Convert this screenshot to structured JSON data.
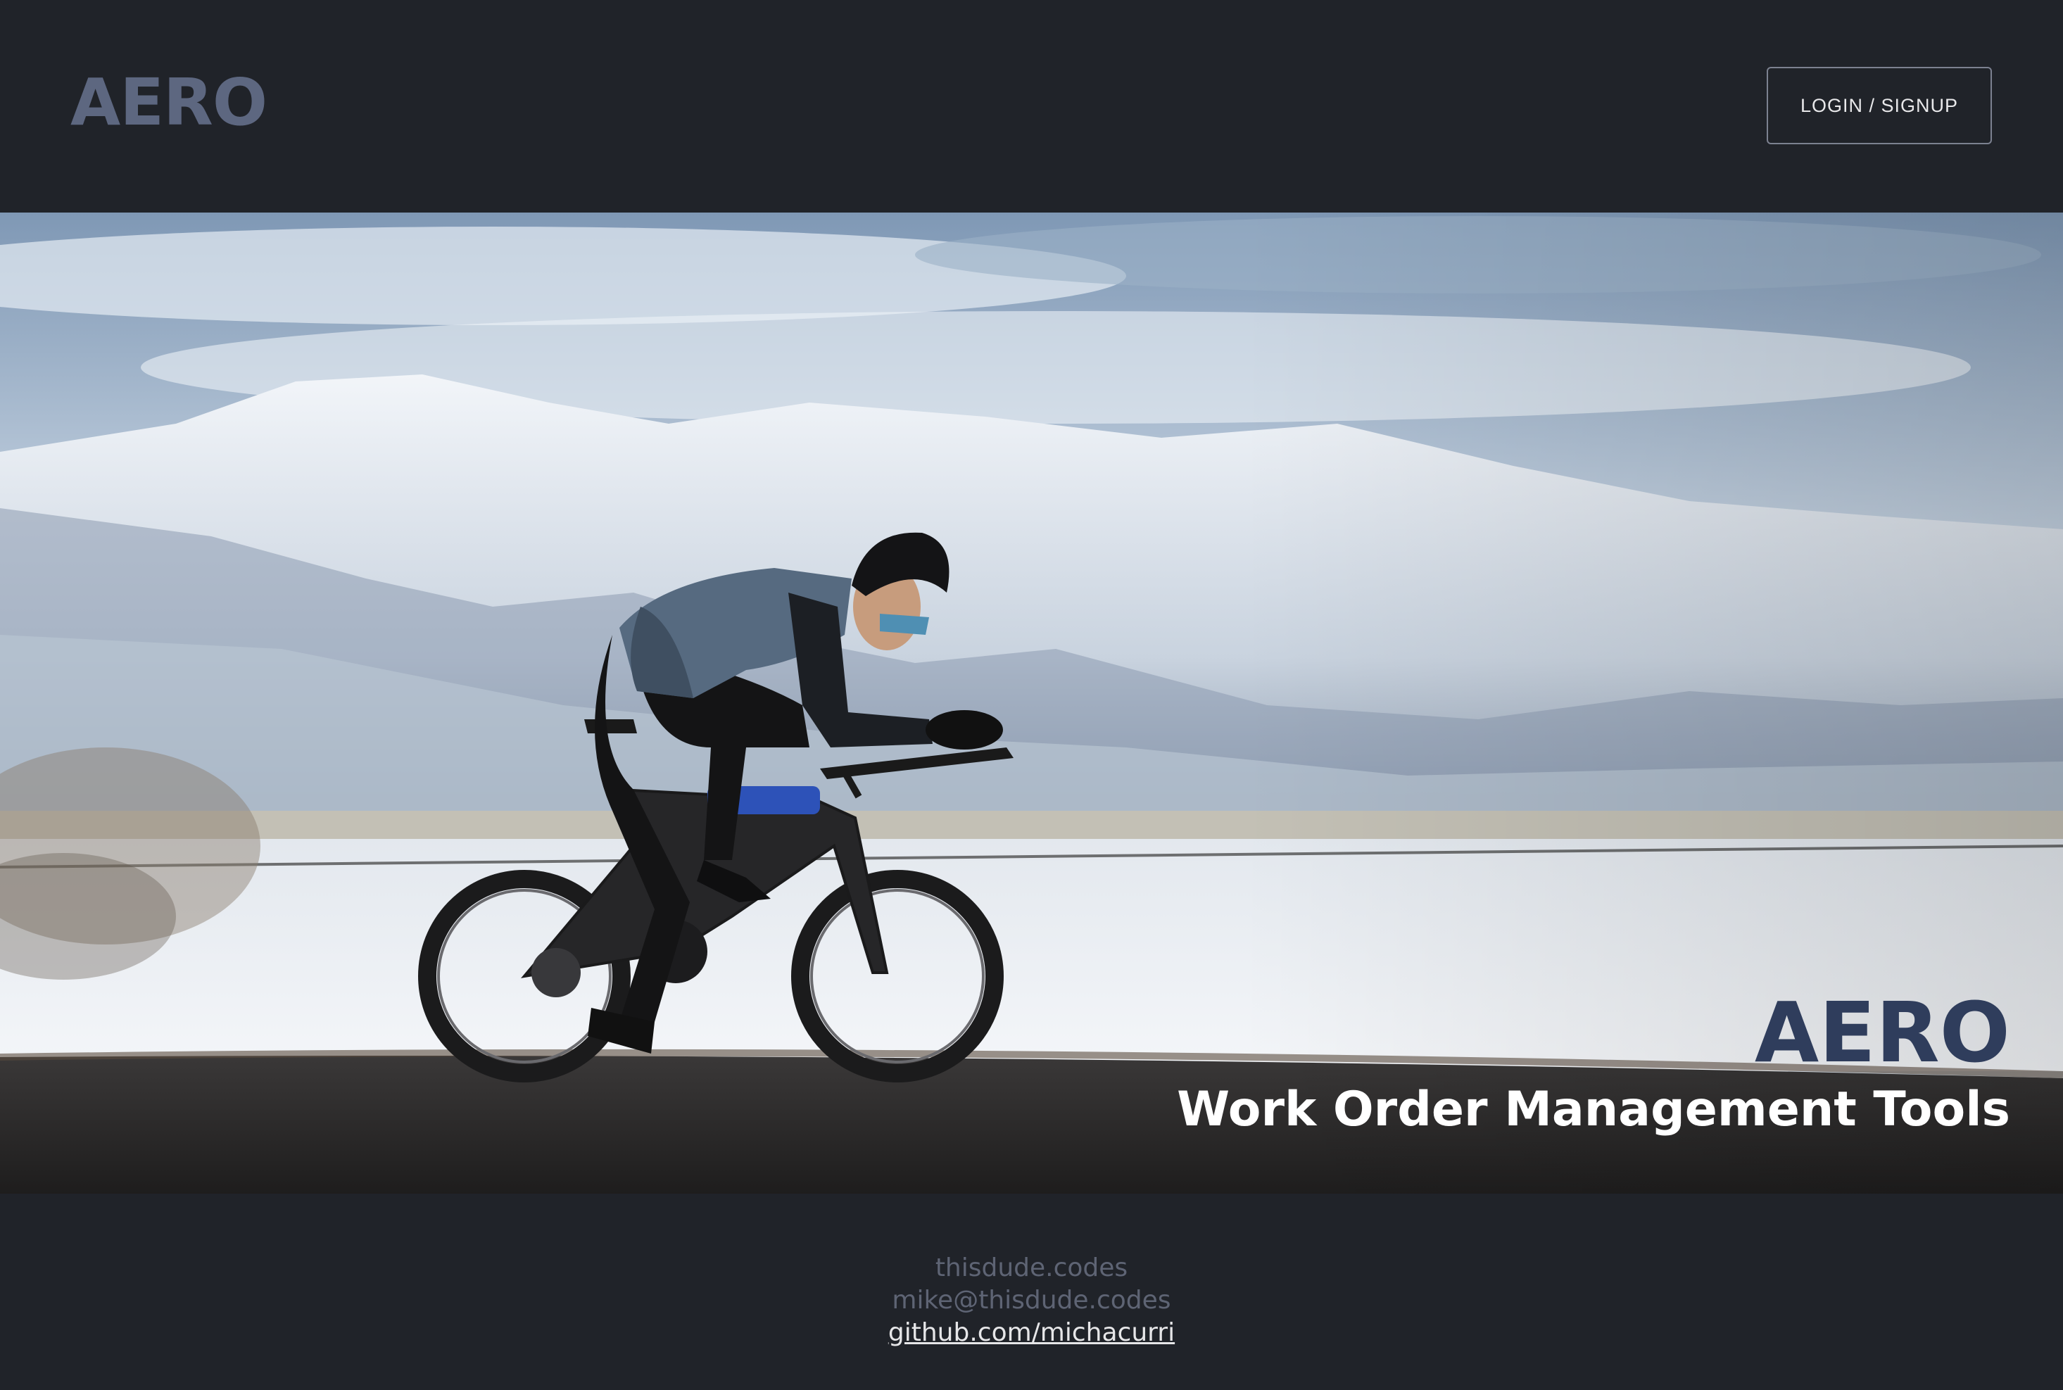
{
  "header": {
    "logo": "AERO",
    "login_label": "LOGIN / SIGNUP"
  },
  "hero": {
    "image_alt": "cyclist-on-time-trial-bike",
    "title": "AERO",
    "subtitle": "Work Order Management Tools"
  },
  "footer": {
    "site": "thisdude.codes",
    "email": "mike@thisdude.codes",
    "github": "github.com/michacurri"
  },
  "colors": {
    "background": "#202329",
    "logo": "#5d6780",
    "hero_title": "#2f3d5c",
    "hero_subtitle": "#ffffff"
  }
}
